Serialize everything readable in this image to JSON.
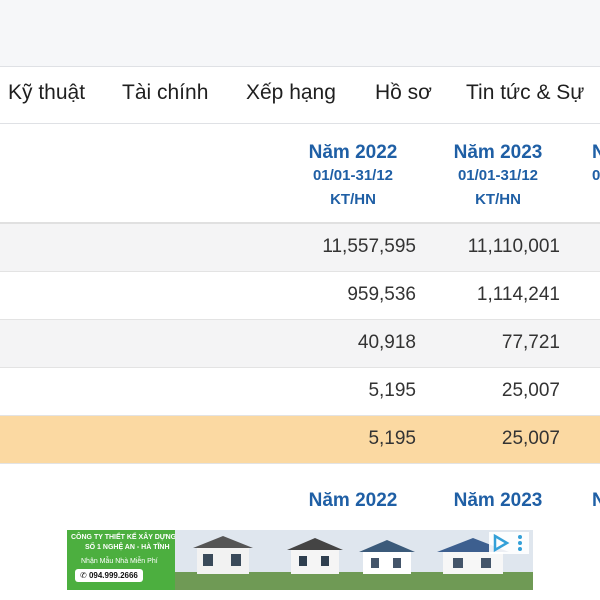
{
  "tabs": [
    "Kỹ thuật",
    "Tài chính",
    "Xếp hạng",
    "Hồ sơ",
    "Tin tức & Sự"
  ],
  "columns": [
    {
      "year": "Năm 2022",
      "period": "01/01-31/12",
      "type": "KT/HN"
    },
    {
      "year": "Năm 2023",
      "period": "01/01-31/12",
      "type": "KT/HN"
    },
    {
      "year": "N",
      "period": "0",
      "type": ""
    }
  ],
  "rows": [
    {
      "v2022": "11,557,595",
      "v2023": "11,110,001"
    },
    {
      "v2022": "959,536",
      "v2023": "1,114,241"
    },
    {
      "v2022": "40,918",
      "v2023": "77,721"
    },
    {
      "v2022": "5,195",
      "v2023": "25,007"
    },
    {
      "v2022": "5,195",
      "v2023": "25,007"
    }
  ],
  "second_header": {
    "y1": "Năm 2022",
    "y2": "Năm 2023",
    "y3": "N"
  },
  "ad": {
    "line1": "CÔNG TY THIẾT KẾ XÂY DỰNG",
    "line2": "SỐ 1 NGHỆ AN - HÀ TĨNH",
    "line3": "Nhận Mẫu Nhà Miễn Phí",
    "phone": "094.999.2666",
    "icon_ads": "ad-choices-icon",
    "icon_menu": "more-vert-icon"
  },
  "colors": {
    "accent": "#1f5fa5",
    "highlight": "#fbd9a2",
    "ad_green": "#4caf3f"
  }
}
